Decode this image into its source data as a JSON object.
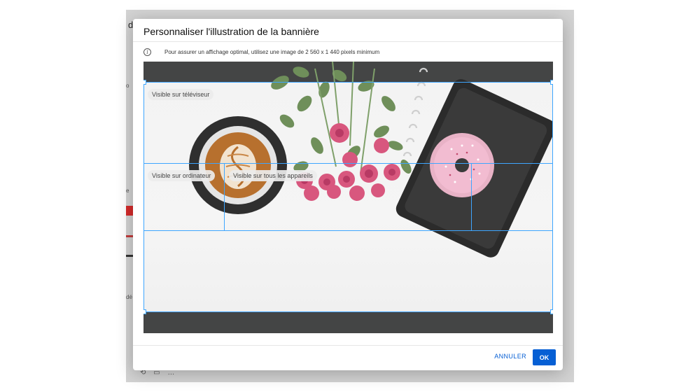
{
  "background_page": {
    "title_fragment": "d",
    "side_marks": [
      "o",
      "e",
      "dé"
    ],
    "bottom_icons": "⟲ ▭ …"
  },
  "dialog": {
    "title": "Personnaliser l'illustration de la bannière",
    "info": {
      "icon": "info-icon",
      "text": "Pour assurer un affichage optimal, utilisez une image de 2 560 x 1 440 pixels minimum"
    },
    "preview": {
      "labels": {
        "tv": "Visible sur téléviseur",
        "desktop": "Visible sur ordinateur",
        "all_devices": "Visible sur tous les appareils"
      },
      "guide_color": "#3ea6ff"
    },
    "footer": {
      "cancel_label": "ANNULER",
      "ok_label": "OK"
    }
  },
  "colors": {
    "accent": "#065fd4",
    "guide": "#3ea6ff",
    "letterbox": "#444545"
  }
}
